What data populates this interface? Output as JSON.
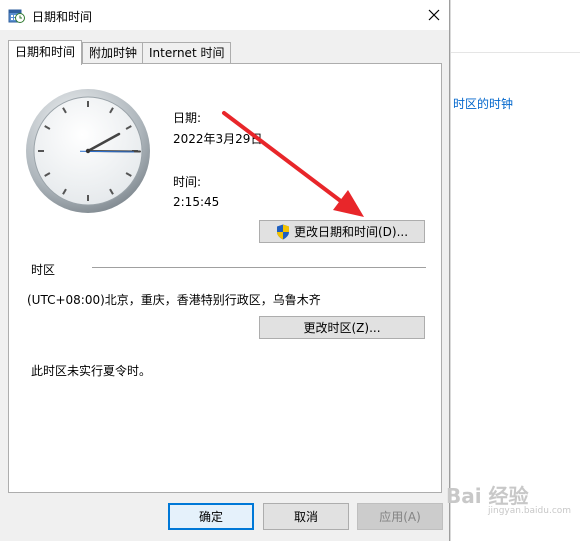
{
  "window": {
    "title": "日期和时间",
    "icon": "date-time-icon"
  },
  "tabs": [
    {
      "label": "日期和时间",
      "active": true
    },
    {
      "label": "附加时钟",
      "active": false
    },
    {
      "label": "Internet 时间",
      "active": false
    }
  ],
  "date_section": {
    "date_label": "日期:",
    "date_value": "2022年3月29日",
    "time_label": "时间:",
    "time_value": "2:15:45",
    "change_button": "更改日期和时间(D)..."
  },
  "timezone_section": {
    "heading": "时区",
    "value": "(UTC+08:00)北京，重庆，香港特别行政区，乌鲁木齐",
    "change_button": "更改时区(Z)...",
    "dst_note": "此时区未实行夏令时。"
  },
  "footer": {
    "ok": "确定",
    "cancel": "取消",
    "apply": "应用(A)"
  },
  "background_window": {
    "link": "时区的时钟"
  },
  "watermark": {
    "main": "Bai 经验",
    "sub": "jingyan.baidu.com"
  },
  "colors": {
    "accent": "#0078d7",
    "arrow": "#e8262a",
    "link": "#0066cc"
  }
}
